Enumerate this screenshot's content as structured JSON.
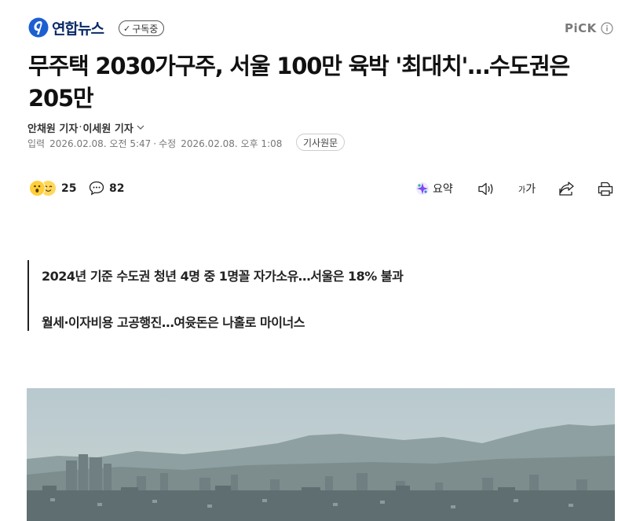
{
  "header": {
    "brand": "연합뉴스",
    "subscribe_label": "구독중",
    "pick_label": "PiCK"
  },
  "article": {
    "headline": "무주택 2030가구주, 서울 100만 육박 '최대치'…수도권은 205만",
    "reporter_1": "안채원 기자",
    "reporter_2": "이세원 기자",
    "published_label": "입력",
    "published": "2026.02.08. 오전 5:47",
    "modified_label": "수정",
    "modified": "2026.02.08. 오후 1:08",
    "original_button": "기사원문",
    "summary_lines": [
      "2024년 기준 수도권 청년 4명 중 1명꼴 자가소유…서울은 18% 불과",
      "월세·이자비용 고공행진…여윳돈은 나홀로 마이너스"
    ]
  },
  "actions": {
    "reaction_count": "25",
    "comment_count": "82",
    "summary_label": "요약",
    "font_size_small": "가",
    "font_size_large": "가"
  },
  "colors": {
    "brand_blue": "#1c5fd1",
    "brand_text": "#0a2a66",
    "summary_icon": "#7a4cf0"
  }
}
